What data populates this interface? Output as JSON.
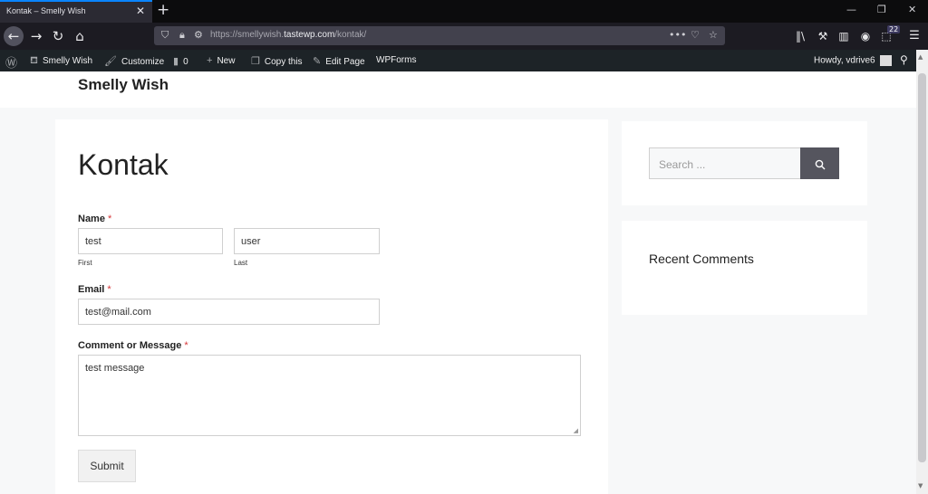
{
  "browser": {
    "tab_title": "Kontak – Smelly Wish",
    "url_prefix": "https://smellywish.",
    "url_domain": "tastewp.com",
    "url_path": "/kontak/",
    "badge_count": "22"
  },
  "admin_bar": {
    "items": [
      {
        "label": "Smelly Wish"
      },
      {
        "label": "Customize"
      },
      {
        "label": "0"
      },
      {
        "label": "New"
      },
      {
        "label": "Copy this"
      },
      {
        "label": "Edit Page"
      },
      {
        "label": "WPForms"
      }
    ],
    "greeting": "Howdy, vdrive6"
  },
  "site": {
    "title": "Smelly Wish"
  },
  "page": {
    "title": "Kontak"
  },
  "form": {
    "name_label": "Name",
    "required_mark": "*",
    "first_value": "test",
    "first_sublabel": "First",
    "last_value": "user",
    "last_sublabel": "Last",
    "email_label": "Email",
    "email_value": "test@mail.com",
    "message_label": "Comment or Message",
    "message_value": "test message",
    "submit_label": "Submit"
  },
  "sidebar": {
    "search_placeholder": "Search ...",
    "recent_comments_title": "Recent Comments"
  },
  "icons": {
    "back": "back-arrow-icon",
    "forward": "forward-arrow-icon",
    "reload": "reload-icon",
    "home": "home-icon",
    "search": "search-icon"
  },
  "colors": {
    "accent": "#0a84ff",
    "admin_bar": "#1d2327",
    "required": "#d63638",
    "search_button": "#55555e"
  }
}
